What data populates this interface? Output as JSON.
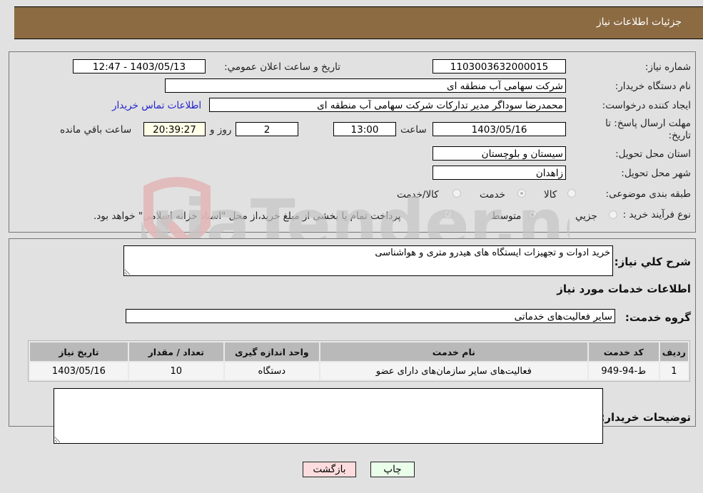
{
  "header": {
    "title": "جزئیات اطلاعات نیاز"
  },
  "fields": {
    "need_number": {
      "label": "شماره نیاز:",
      "value": "1103003632000015"
    },
    "announce_datetime": {
      "label": "تاریخ و ساعت اعلان عمومي:",
      "value": "1403/05/13 - 12:47"
    },
    "buyer_org": {
      "label": "نام دستگاه خریدار:",
      "value": "شرکت سهامی آب منطقه ای"
    },
    "requester": {
      "label": "ایجاد کننده درخواست:",
      "value": "محمدرضا سوداگر مدیر تدارکات شرکت سهامی آب منطقه ای"
    },
    "buyer_contact_link": "اطلاعات تماس خریدار",
    "deadline": {
      "label_line1": "مهلت ارسال پاسخ: تا",
      "label_line2": "تاریخ:",
      "date": "1403/05/16",
      "time_label": "ساعت",
      "time": "13:00",
      "days": "2",
      "days_label": "روز و",
      "remaining": "20:39:27",
      "remaining_label": "ساعت باقي مانده"
    },
    "province": {
      "label": "استان محل تحویل:",
      "value": "سیستان و بلوچستان"
    },
    "city": {
      "label": "شهر محل تحویل:",
      "value": "زاهدان"
    },
    "category": {
      "label": "طبقه بندی موضوعی:",
      "options": [
        {
          "label": "کالا",
          "checked": false
        },
        {
          "label": "خدمت",
          "checked": true
        },
        {
          "label": "کالا/خدمت",
          "checked": false
        }
      ]
    },
    "purchase_type": {
      "label": "نوع فرآیند خرید :",
      "options": [
        {
          "label": "جزيي",
          "checked": false
        },
        {
          "label": "متوسط",
          "checked": true
        }
      ],
      "treasury_checkbox": {
        "label": "پرداخت تمام یا بخشی از مبلغ خرید،از محل \"اسناد خزانه اسلامی\" خواهد بود.",
        "checked": true
      }
    }
  },
  "description": {
    "label": "شرح کلي نياز:",
    "value": "خرید ادوات و تجهیزات ایستگاه های هیدرو متری و هواشناسی"
  },
  "services_section_title": "اطلاعات خدمات مورد نیاز",
  "service_group": {
    "label": "گروه خدمت:",
    "value": "سایر فعالیت‌های خدماتی"
  },
  "table": {
    "headers": [
      "ردیف",
      "کد خدمت",
      "نام خدمت",
      "واحد اندازه گیری",
      "تعداد / مقدار",
      "تاریخ نیاز"
    ],
    "rows": [
      [
        "1",
        "ط-94-949",
        "فعالیت‌های سایر سازمان‌های دارای عضو",
        "دستگاه",
        "10",
        "1403/05/16"
      ]
    ]
  },
  "buyer_notes": {
    "label": "توضیحات خریدار:",
    "value": ""
  },
  "buttons": {
    "print": "چاپ",
    "back": "بازگشت"
  },
  "watermark": {
    "text": "AriaTender.neT"
  }
}
